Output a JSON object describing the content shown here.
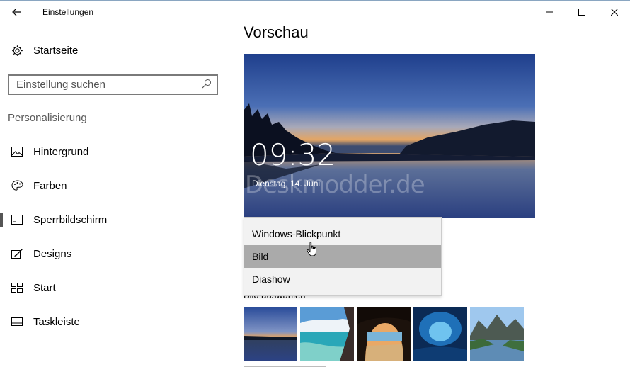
{
  "window": {
    "title": "Einstellungen"
  },
  "sidebar": {
    "home_label": "Startseite",
    "search_placeholder": "Einstellung suchen",
    "section_label": "Personalisierung",
    "items": [
      {
        "label": "Hintergrund",
        "icon": "picture-icon"
      },
      {
        "label": "Farben",
        "icon": "palette-icon"
      },
      {
        "label": "Sperrbildschirm",
        "icon": "lockscreen-icon",
        "selected": true
      },
      {
        "label": "Designs",
        "icon": "brush-icon"
      },
      {
        "label": "Start",
        "icon": "start-grid-icon"
      },
      {
        "label": "Taskleiste",
        "icon": "taskbar-icon"
      }
    ]
  },
  "main": {
    "preview_title": "Vorschau",
    "lock_time": "09:32",
    "lock_date": "Dienstag, 14. Juni",
    "watermark": "Deskmodder.de",
    "background_dropdown": {
      "options": [
        "Windows-Blickpunkt",
        "Bild",
        "Diashow"
      ],
      "highlighted": "Bild"
    },
    "choose_picture_label": "Bild auswählen",
    "thumbnails": [
      "lake-sunset",
      "tropical-beach",
      "rock-arch-beach",
      "ice-cave",
      "mountain-lake"
    ]
  },
  "colors": {
    "accent_selected_bar": "#555555",
    "dropdown_bg": "#f2f2f2",
    "dropdown_highlight": "#aaaaaa",
    "search_border": "#7a7a7a"
  }
}
